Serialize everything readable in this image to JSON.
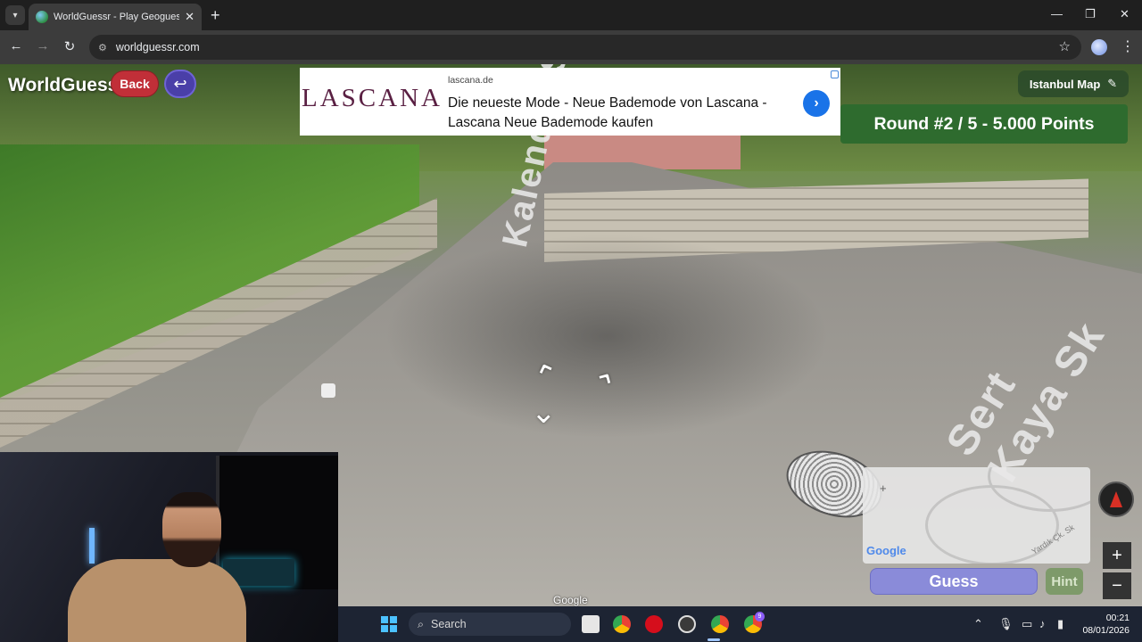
{
  "browser": {
    "tab_title": "WorldGuessr - Play Geoguessr F",
    "url": "worldguessr.com"
  },
  "game": {
    "logo": "WorldGuessr",
    "back_label": "Back",
    "map_name": "Istanbul Map",
    "round_banner": "Round #2 / 5 - 5.000 Points",
    "guess_label": "Guess",
    "hint_label": "Hint"
  },
  "ad": {
    "brand": "LASCANA",
    "domain": "lascana.de",
    "headline": "Die neueste Mode - Neue Bademode von Lascana - Lascana Neue Bademode kaufen"
  },
  "street_view": {
    "street_name_1": "Kalender Sk",
    "street_name_2": "Sert Kaya Sk",
    "attribution": "Google"
  },
  "minimap": {
    "attribution": "Google",
    "street_label": "Yardık Çk. Sk"
  },
  "taskbar": {
    "search_placeholder": "Search",
    "time": "00:21",
    "date": "08/01/2026",
    "notification_badge": "9"
  },
  "colors": {
    "back_button": "#c12f38",
    "round_banner": "#2e6b2e",
    "guess_button": "#8a8bd9",
    "ad_brand": "#5a2043",
    "taskbar": "#1d2433"
  }
}
